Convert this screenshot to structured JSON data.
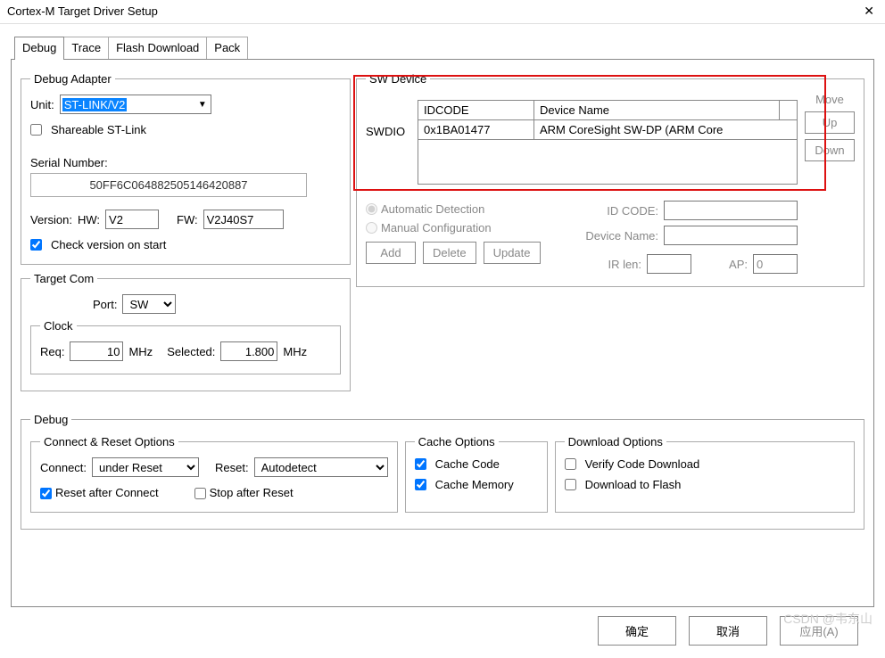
{
  "window": {
    "title": "Cortex-M Target Driver Setup"
  },
  "tabs": [
    "Debug",
    "Trace",
    "Flash Download",
    "Pack"
  ],
  "debugAdapter": {
    "legend": "Debug Adapter",
    "unitLabel": "Unit:",
    "unitValue": "ST-LINK/V2",
    "shareableLabel": "Shareable ST-Link",
    "serialLabel": "Serial Number:",
    "serialValue": "50FF6C064882505146420887",
    "versionLabel": "Version:",
    "hwLabel": "HW:",
    "hwValue": "V2",
    "fwLabel": "FW:",
    "fwValue": "V2J40S7",
    "checkVersionLabel": "Check version on start"
  },
  "targetCom": {
    "legend": "Target Com",
    "portLabel": "Port:",
    "portValue": "SW",
    "clockLegend": "Clock",
    "reqLabel": "Req:",
    "reqValue": "10",
    "reqUnit": "MHz",
    "selectedLabel": "Selected:",
    "selectedValue": "1.800",
    "selectedUnit": "MHz"
  },
  "swDevice": {
    "legend": "SW Device",
    "swdioLabel": "SWDIO",
    "idcodeHeader": "IDCODE",
    "nameHeader": "Device Name",
    "row": {
      "idcode": "0x1BA01477",
      "name": "ARM CoreSight SW-DP (ARM Core"
    },
    "moveLabel": "Move",
    "upLabel": "Up",
    "downLabel": "Down",
    "autoLabel": "Automatic Detection",
    "manualLabel": "Manual Configuration",
    "idCodeLabel": "ID CODE:",
    "devNameLabel": "Device Name:",
    "addLabel": "Add",
    "deleteLabel": "Delete",
    "updateLabel": "Update",
    "irLenLabel": "IR len:",
    "apLabel": "AP:",
    "apValue": "0"
  },
  "debug": {
    "legend": "Debug",
    "connectReset": {
      "legend": "Connect & Reset Options",
      "connectLabel": "Connect:",
      "connectValue": "under Reset",
      "resetLabel": "Reset:",
      "resetValue": "Autodetect",
      "resetAfterLabel": "Reset after Connect",
      "stopAfterLabel": "Stop after Reset"
    },
    "cache": {
      "legend": "Cache Options",
      "codeLabel": "Cache Code",
      "memoryLabel": "Cache Memory"
    },
    "download": {
      "legend": "Download Options",
      "verifyLabel": "Verify Code Download",
      "flashLabel": "Download to Flash"
    }
  },
  "buttons": {
    "ok": "确定",
    "cancel": "取消",
    "apply": "应用(A)"
  },
  "watermark": "CSDN @韦东山"
}
